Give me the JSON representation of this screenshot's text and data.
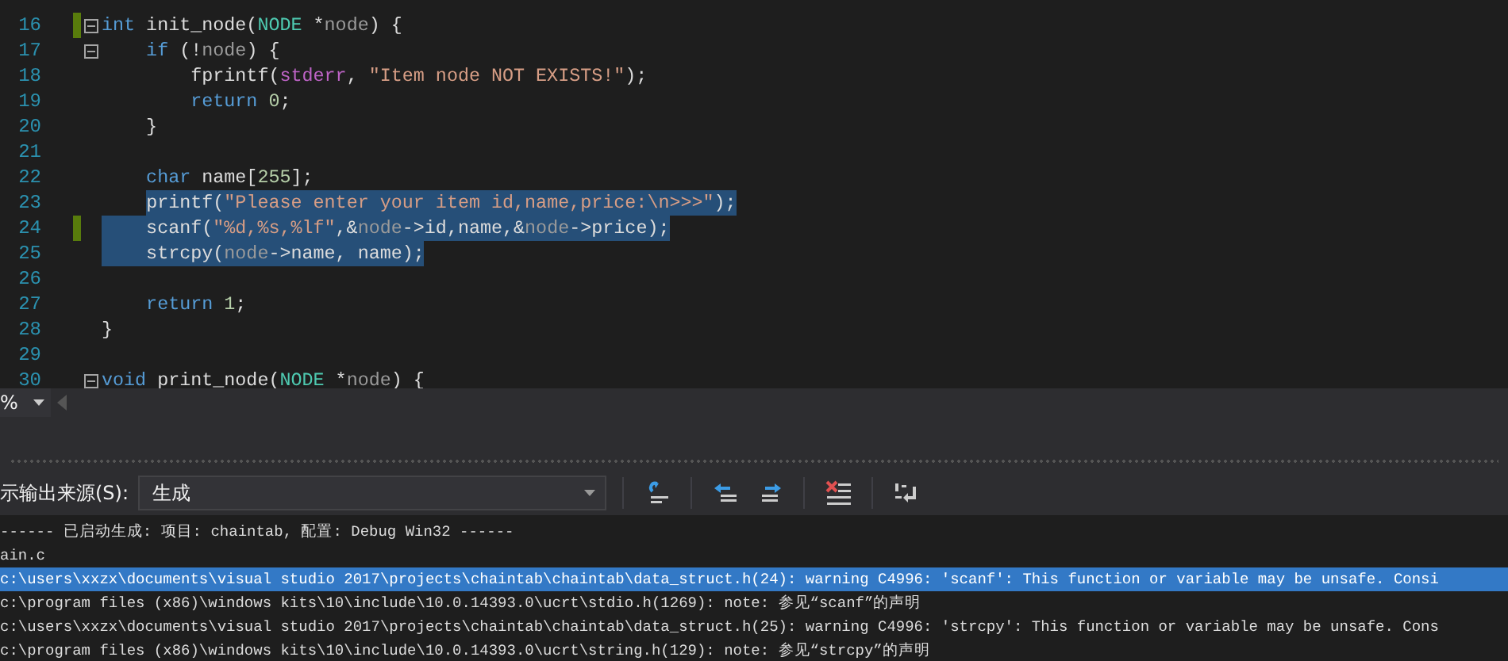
{
  "editor": {
    "lines": [
      {
        "number": "16",
        "fold": true,
        "changed": true,
        "selected": false,
        "tokens": [
          {
            "text": "int",
            "kind": "keyword"
          },
          {
            "text": " init_node(",
            "kind": "plain"
          },
          {
            "text": "NODE",
            "kind": "type"
          },
          {
            "text": " *",
            "kind": "plain"
          },
          {
            "text": "node",
            "kind": "param"
          },
          {
            "text": ") {",
            "kind": "plain"
          }
        ]
      },
      {
        "number": "17",
        "fold": true,
        "changed": false,
        "selected": false,
        "tokens": [
          {
            "text": "    if",
            "kind": "keyword"
          },
          {
            "text": " (!",
            "kind": "plain"
          },
          {
            "text": "node",
            "kind": "param"
          },
          {
            "text": ") {",
            "kind": "plain"
          }
        ]
      },
      {
        "number": "18",
        "fold": false,
        "changed": false,
        "selected": false,
        "tokens": [
          {
            "text": "        fprintf(",
            "kind": "plain"
          },
          {
            "text": "stderr",
            "kind": "macro"
          },
          {
            "text": ", ",
            "kind": "plain"
          },
          {
            "text": "\"Item node NOT EXISTS!\"",
            "kind": "string"
          },
          {
            "text": ");",
            "kind": "plain"
          }
        ]
      },
      {
        "number": "19",
        "fold": false,
        "changed": false,
        "selected": false,
        "tokens": [
          {
            "text": "        return",
            "kind": "keyword"
          },
          {
            "text": " 0",
            "kind": "number"
          },
          {
            "text": ";",
            "kind": "plain"
          }
        ]
      },
      {
        "number": "20",
        "fold": false,
        "changed": false,
        "selected": false,
        "tokens": [
          {
            "text": "    }",
            "kind": "plain"
          }
        ]
      },
      {
        "number": "21",
        "fold": false,
        "changed": false,
        "selected": false
      },
      {
        "number": "22",
        "fold": false,
        "changed": false,
        "selected": false,
        "tokens": [
          {
            "text": "    char",
            "kind": "keyword"
          },
          {
            "text": " name[",
            "kind": "plain"
          },
          {
            "text": "255",
            "kind": "number"
          },
          {
            "text": "];",
            "kind": "plain"
          }
        ]
      },
      {
        "number": "23",
        "fold": false,
        "changed": false,
        "selected": true,
        "tokens": [
          {
            "text": "    printf(",
            "kind": "plain"
          },
          {
            "text": "\"Please enter your item id,name,price:\\n>>>\"",
            "kind": "string"
          },
          {
            "text": ");",
            "kind": "plain"
          }
        ]
      },
      {
        "number": "24",
        "fold": false,
        "changed": true,
        "selected": true,
        "tokens": [
          {
            "text": "    scanf(",
            "kind": "plain"
          },
          {
            "text": "\"%d,%s,%lf\"",
            "kind": "string"
          },
          {
            "text": ",&",
            "kind": "plain"
          },
          {
            "text": "node",
            "kind": "param"
          },
          {
            "text": "->id,name,&",
            "kind": "plain"
          },
          {
            "text": "node",
            "kind": "param"
          },
          {
            "text": "->price);",
            "kind": "plain"
          }
        ]
      },
      {
        "number": "25",
        "fold": false,
        "changed": false,
        "selected": true,
        "tokens": [
          {
            "text": "    strcpy(",
            "kind": "plain"
          },
          {
            "text": "node",
            "kind": "param"
          },
          {
            "text": "->name, name);",
            "kind": "plain"
          }
        ]
      },
      {
        "number": "26",
        "fold": false,
        "changed": false,
        "selected": false
      },
      {
        "number": "27",
        "fold": false,
        "changed": false,
        "selected": false,
        "tokens": [
          {
            "text": "    return",
            "kind": "keyword"
          },
          {
            "text": " 1",
            "kind": "number"
          },
          {
            "text": ";",
            "kind": "plain"
          }
        ]
      },
      {
        "number": "28",
        "fold": false,
        "changed": false,
        "selected": false,
        "tokens": [
          {
            "text": "}",
            "kind": "plain"
          }
        ]
      },
      {
        "number": "29",
        "fold": false,
        "changed": false,
        "selected": false
      },
      {
        "number": "30",
        "fold": true,
        "changed": false,
        "selected": false,
        "tokens": [
          {
            "text": "void",
            "kind": "keyword"
          },
          {
            "text": " print_node(",
            "kind": "plain"
          },
          {
            "text": "NODE",
            "kind": "type"
          },
          {
            "text": " *",
            "kind": "plain"
          },
          {
            "text": "node",
            "kind": "param"
          },
          {
            "text": ") {",
            "kind": "plain"
          }
        ]
      }
    ]
  },
  "zoom": {
    "value": "%"
  },
  "output": {
    "source_label": "示输出来源(S):",
    "source_value": "生成",
    "lines": [
      {
        "text": "------ 已启动生成: 项目: chaintab, 配置: Debug Win32 ------",
        "selected": false
      },
      {
        "text": "ain.c",
        "selected": false
      },
      {
        "text": "c:\\users\\xxzx\\documents\\visual studio 2017\\projects\\chaintab\\chaintab\\data_struct.h(24): warning C4996: 'scanf': This function or variable may be unsafe. Consi",
        "selected": true
      },
      {
        "text": "c:\\program files (x86)\\windows kits\\10\\include\\10.0.14393.0\\ucrt\\stdio.h(1269): note: 参见“scanf”的声明",
        "selected": false
      },
      {
        "text": "c:\\users\\xxzx\\documents\\visual studio 2017\\projects\\chaintab\\chaintab\\data_struct.h(25): warning C4996: 'strcpy': This function or variable may be unsafe. Cons",
        "selected": false
      },
      {
        "text": "c:\\program files (x86)\\windows kits\\10\\include\\10.0.14393.0\\ucrt\\string.h(129): note: 参见“strcpy”的声明",
        "selected": false
      }
    ]
  }
}
